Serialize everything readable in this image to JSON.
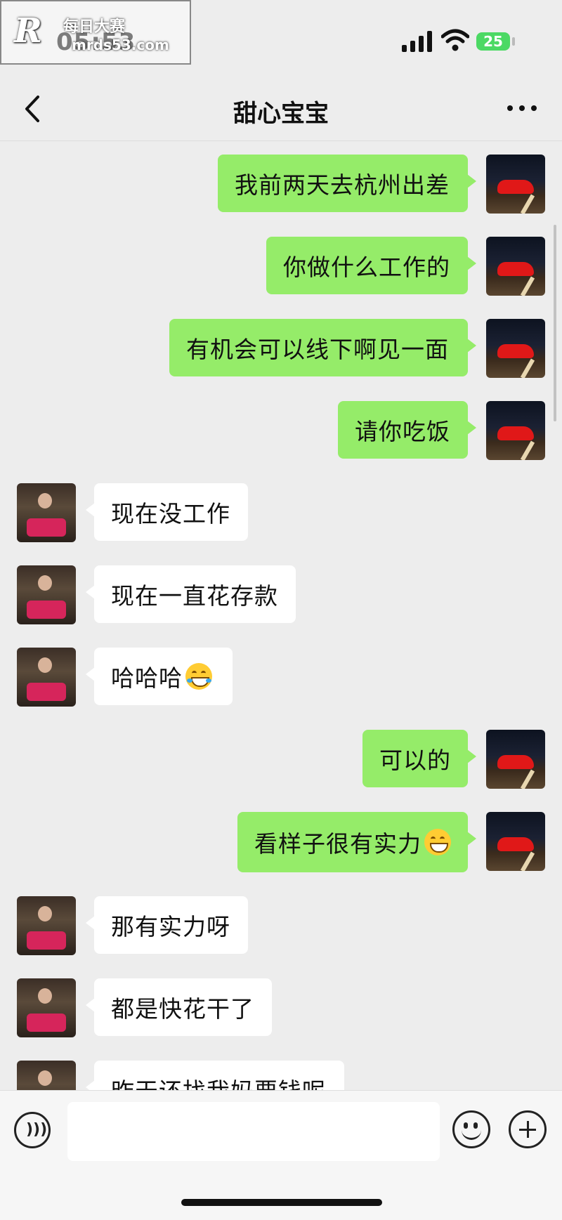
{
  "status": {
    "time": "05:53",
    "battery": "25"
  },
  "watermark": {
    "logo": "R",
    "line1": "每日大赛",
    "line2": "mrds53.com"
  },
  "header": {
    "title": "甜心宝宝"
  },
  "messages": [
    {
      "side": "out",
      "text": "我前两天去杭州出差"
    },
    {
      "side": "out",
      "text": "你做什么工作的"
    },
    {
      "side": "out",
      "text": "有机会可以线下啊见一面"
    },
    {
      "side": "out",
      "text": "请你吃饭"
    },
    {
      "side": "in",
      "text": "现在没工作"
    },
    {
      "side": "in",
      "text": "现在一直花存款"
    },
    {
      "side": "in",
      "text": "哈哈哈",
      "emoji": "tears-of-joy"
    },
    {
      "side": "out",
      "text": "可以的"
    },
    {
      "side": "out",
      "text": "看样子很有实力",
      "emoji": "grin"
    },
    {
      "side": "in",
      "text": "那有实力呀"
    },
    {
      "side": "in",
      "text": "都是快花干了"
    },
    {
      "side": "in",
      "text": "昨天还找我妈要钱呢"
    }
  ],
  "icons": {
    "back": "chevron-left-icon",
    "more": "more-icon",
    "voice": "voice-icon",
    "emoji": "emoji-icon",
    "add": "plus-icon"
  }
}
